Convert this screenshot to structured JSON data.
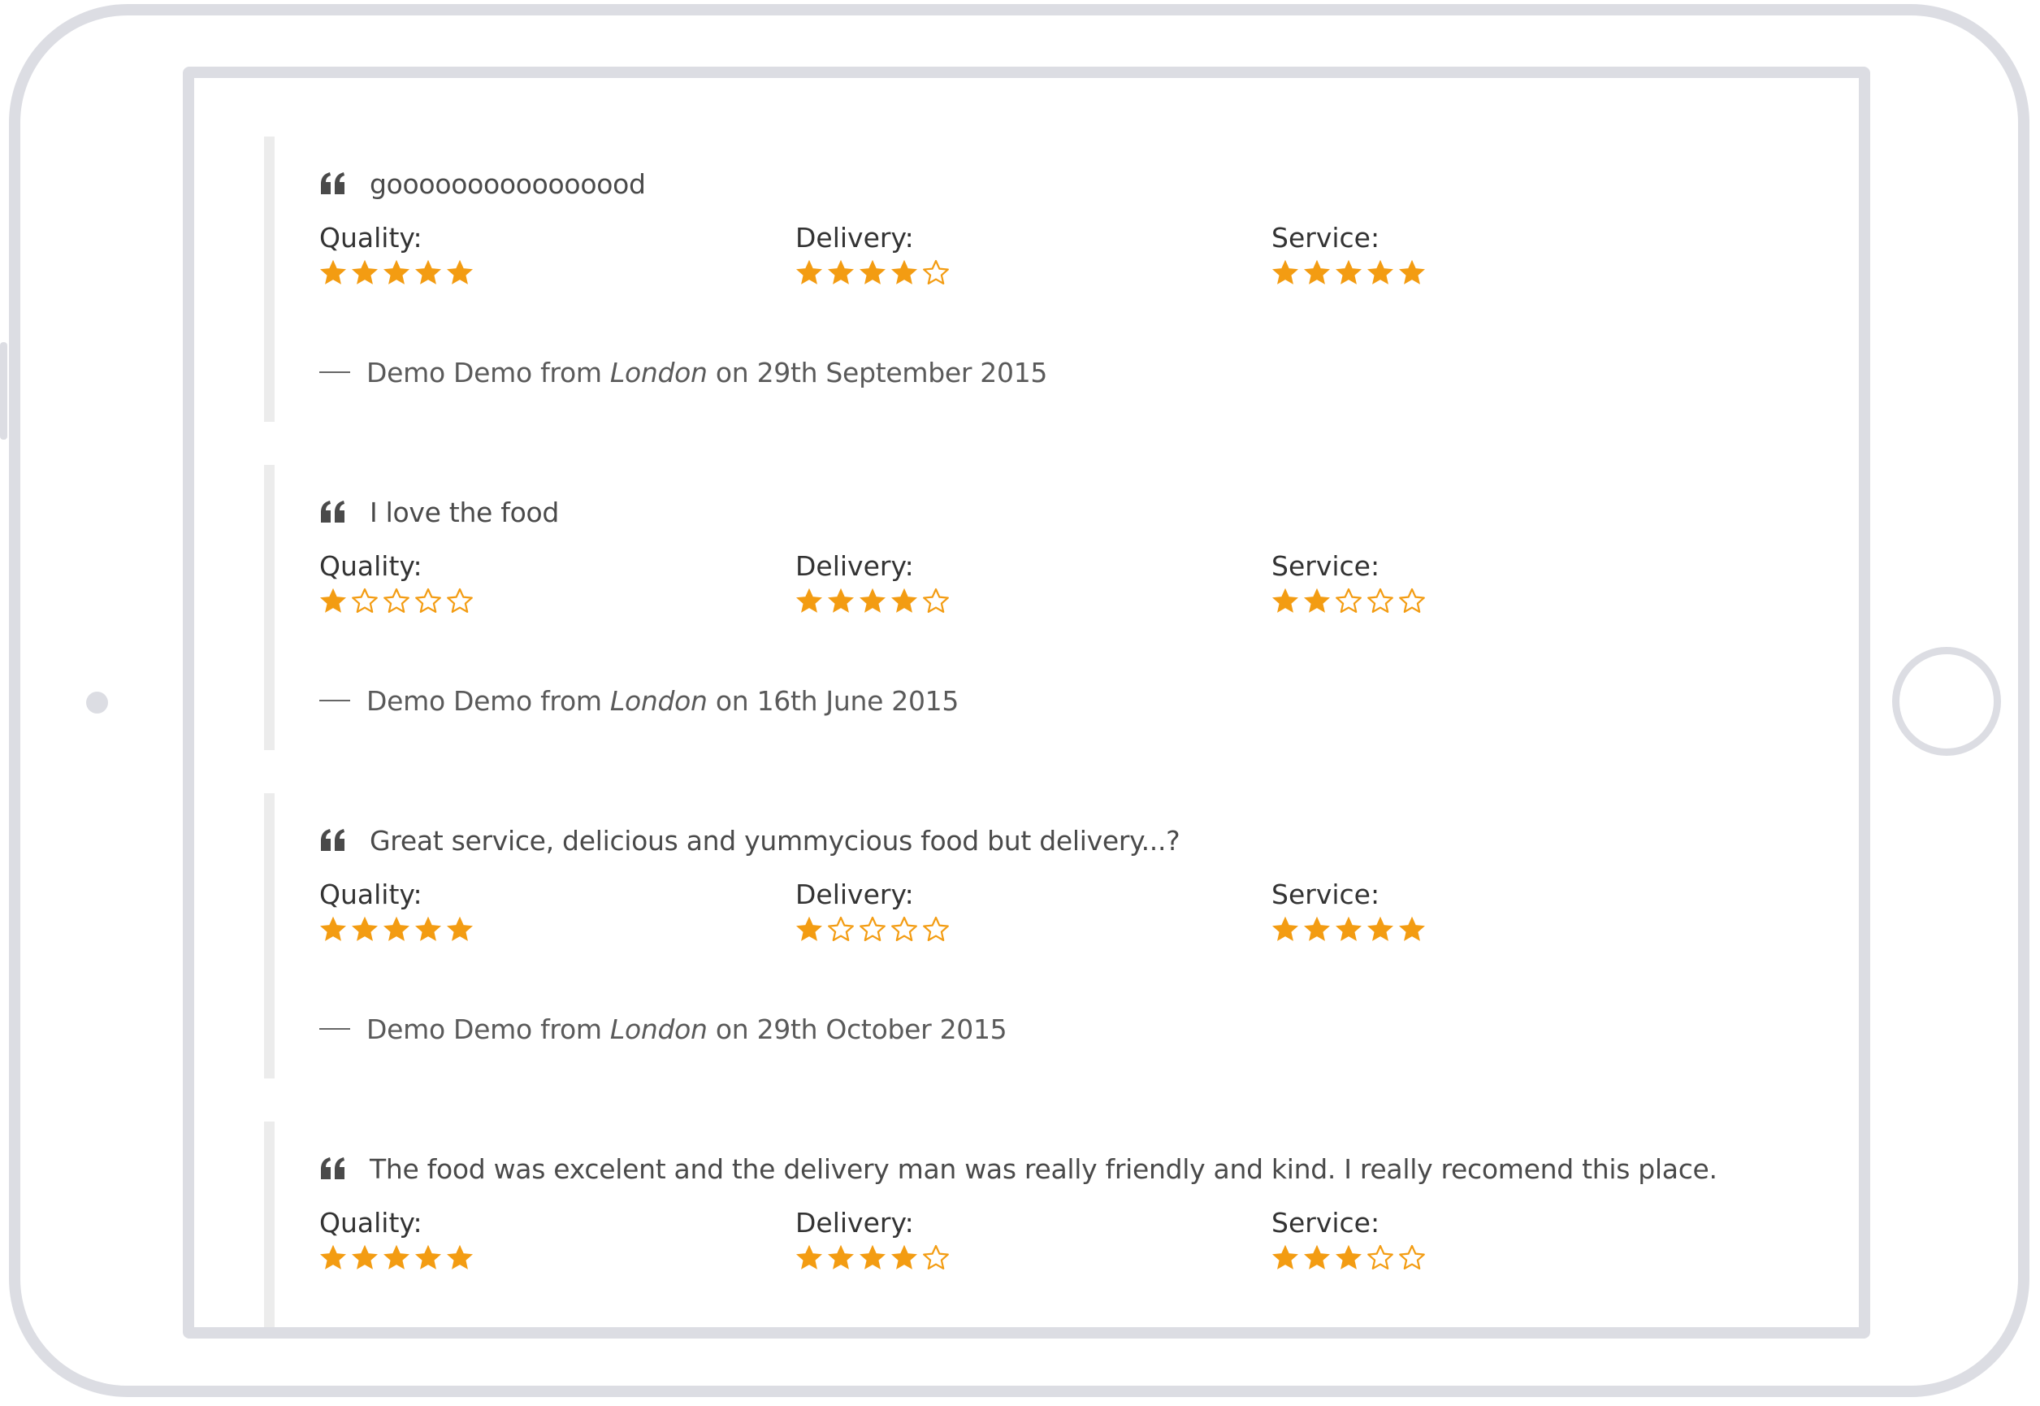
{
  "colors": {
    "star_filled": "#f39c12",
    "frame": "#dcdde3",
    "quote_bar": "#ececec"
  },
  "icons": {
    "quote": "quote-left-icon",
    "star_filled": "star-filled-icon",
    "star_empty": "star-outline-icon"
  },
  "labels": {
    "quality": "Quality:",
    "delivery": "Delivery:",
    "service": "Service:",
    "from": "from",
    "on": "on"
  },
  "reviews": [
    {
      "text": "goooooooooooooood",
      "quality": 5,
      "delivery": 4,
      "service": 5,
      "author": "Demo Demo",
      "location": "London",
      "date": "29th September 2015"
    },
    {
      "text": "I love the food",
      "quality": 1,
      "delivery": 4,
      "service": 2,
      "author": "Demo Demo",
      "location": "London",
      "date": "16th June 2015"
    },
    {
      "text": "Great service, delicious and yummycious food but delivery...?",
      "quality": 5,
      "delivery": 1,
      "service": 5,
      "author": "Demo Demo",
      "location": "London",
      "date": "29th October 2015"
    },
    {
      "text": "The food was excelent and the delivery man was really friendly and kind. I really recomend this place.",
      "quality": 5,
      "delivery": 4,
      "service": 3
    }
  ]
}
